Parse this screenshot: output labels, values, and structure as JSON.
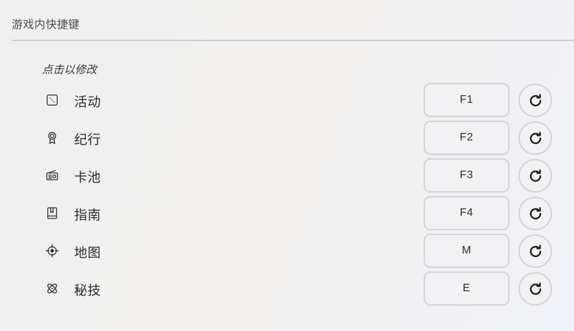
{
  "section": {
    "title": "游戏内快捷键",
    "hint": "点击以修改"
  },
  "shortcuts": [
    {
      "label": "活动",
      "key": "F1",
      "icon": "dice-icon"
    },
    {
      "label": "纪行",
      "key": "F2",
      "icon": "medal-icon"
    },
    {
      "label": "卡池",
      "key": "F3",
      "icon": "radio-icon"
    },
    {
      "label": "指南",
      "key": "F4",
      "icon": "book-icon"
    },
    {
      "label": "地图",
      "key": "M",
      "icon": "compass-target-icon"
    },
    {
      "label": "秘技",
      "key": "E",
      "icon": "atom-icon"
    }
  ],
  "colors": {
    "text": "#2b2b2b",
    "border": "#d4d4d8",
    "divider": "#cfcfd2"
  }
}
